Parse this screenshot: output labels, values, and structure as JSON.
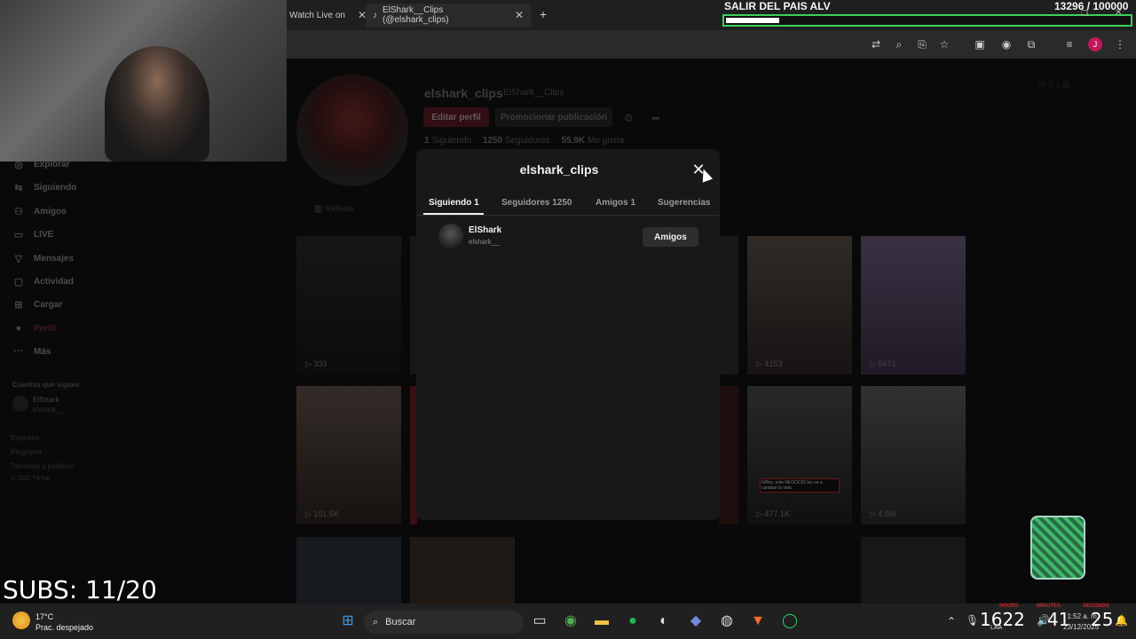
{
  "browser": {
    "tabs": [
      {
        "label": "Watch Live on",
        "close": "✕"
      },
      {
        "label": "ElShark__Clips (@elshark_clips)",
        "close": "✕"
      }
    ],
    "new_tab": "+"
  },
  "sidebar": {
    "items": [
      {
        "label": "Explorar",
        "icon": "compass-icon"
      },
      {
        "label": "Siguiendo",
        "icon": "following-icon"
      },
      {
        "label": "Amigos",
        "icon": "friends-icon"
      },
      {
        "label": "LIVE",
        "icon": "live-icon"
      },
      {
        "label": "Mensajes",
        "icon": "messages-icon"
      },
      {
        "label": "Actividad",
        "icon": "activity-icon"
      },
      {
        "label": "Cargar",
        "icon": "upload-icon"
      },
      {
        "label": "Perfil",
        "icon": "profile-icon"
      },
      {
        "label": "Más",
        "icon": "more-icon"
      }
    ],
    "following_header": "Cuentas que sigues",
    "following_account": {
      "name": "ElShark",
      "handle": "elshark__"
    },
    "footer": [
      "Empresa",
      "Programa",
      "Términos y políticas",
      "© 2025 TikTok"
    ]
  },
  "profile": {
    "username": "elshark_clips",
    "nickname": "ElShark__Clips",
    "edit_label": "Editar perfil",
    "promote_label": "Promocionar publicación",
    "following_count": "1",
    "following_label": "Siguiendo",
    "followers_count": "1250",
    "followers_label": "Seguidores",
    "likes_count": "55.9K",
    "likes_label": "Me gusta",
    "tab_videos": "Videos"
  },
  "grid": {
    "views": [
      "333",
      "4153",
      "5671",
      "101.5K",
      "477.1K",
      "4.5M"
    ],
    "caption": "Niños, este NEGOCIO les va a cambiar la vida"
  },
  "modal": {
    "title": "elshark_clips",
    "close": "✕",
    "tabs": [
      "Siguiendo 1",
      "Seguidores 1250",
      "Amigos 1",
      "Sugerencias"
    ],
    "row": {
      "name": "ElShark",
      "handle": "elshark__",
      "button": "Amigos"
    }
  },
  "stream": {
    "goal_title": "SALIR DEL PAIS ALV",
    "goal_count": "13296",
    "goal_total": "/ 100000",
    "goal_progress": 0.133,
    "subs_text": "SUBS: 11/20"
  },
  "taskbar": {
    "temp": "17°C",
    "weather": "Prac. despejado",
    "search": "Buscar",
    "timer": {
      "hours": "16",
      "minutes": "22",
      "seconds": "41",
      "extra": "25",
      "labels": [
        "HOURS",
        "MINUTES",
        "SECONDS"
      ]
    },
    "clock_time": "1:52 a. m.",
    "clock_date": "23/12/2025",
    "lang": "LAA"
  },
  "colors": {
    "accent": "#fe2c55",
    "goal_border": "#3cd05a"
  }
}
